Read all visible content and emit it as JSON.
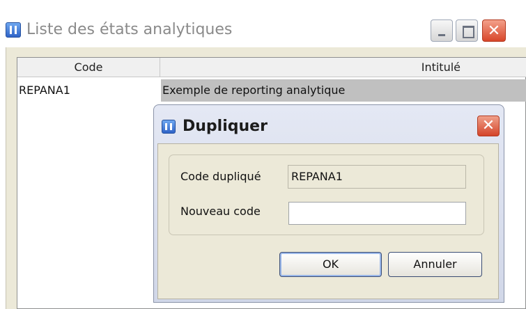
{
  "window": {
    "title": "Liste des états analytiques",
    "controls": [
      "minimize-icon",
      "maximize-icon",
      "close-icon"
    ]
  },
  "table": {
    "columns": [
      "Code",
      "Intitulé"
    ],
    "rows": [
      {
        "code": "REPANA1",
        "intitule": "Exemple de reporting analytique",
        "selected": true
      }
    ]
  },
  "dialog": {
    "title": "Dupliquer",
    "fields": {
      "code_duplique": {
        "label": "Code dupliqué",
        "value": "REPANA1"
      },
      "nouveau_code": {
        "label": "Nouveau code",
        "value": ""
      }
    },
    "buttons": {
      "ok": "OK",
      "cancel": "Annuler"
    }
  },
  "colors": {
    "selected_row": "#c0c0c0",
    "dialog_title_bg": "#d1d7e8",
    "close_button": "#d8462a"
  }
}
